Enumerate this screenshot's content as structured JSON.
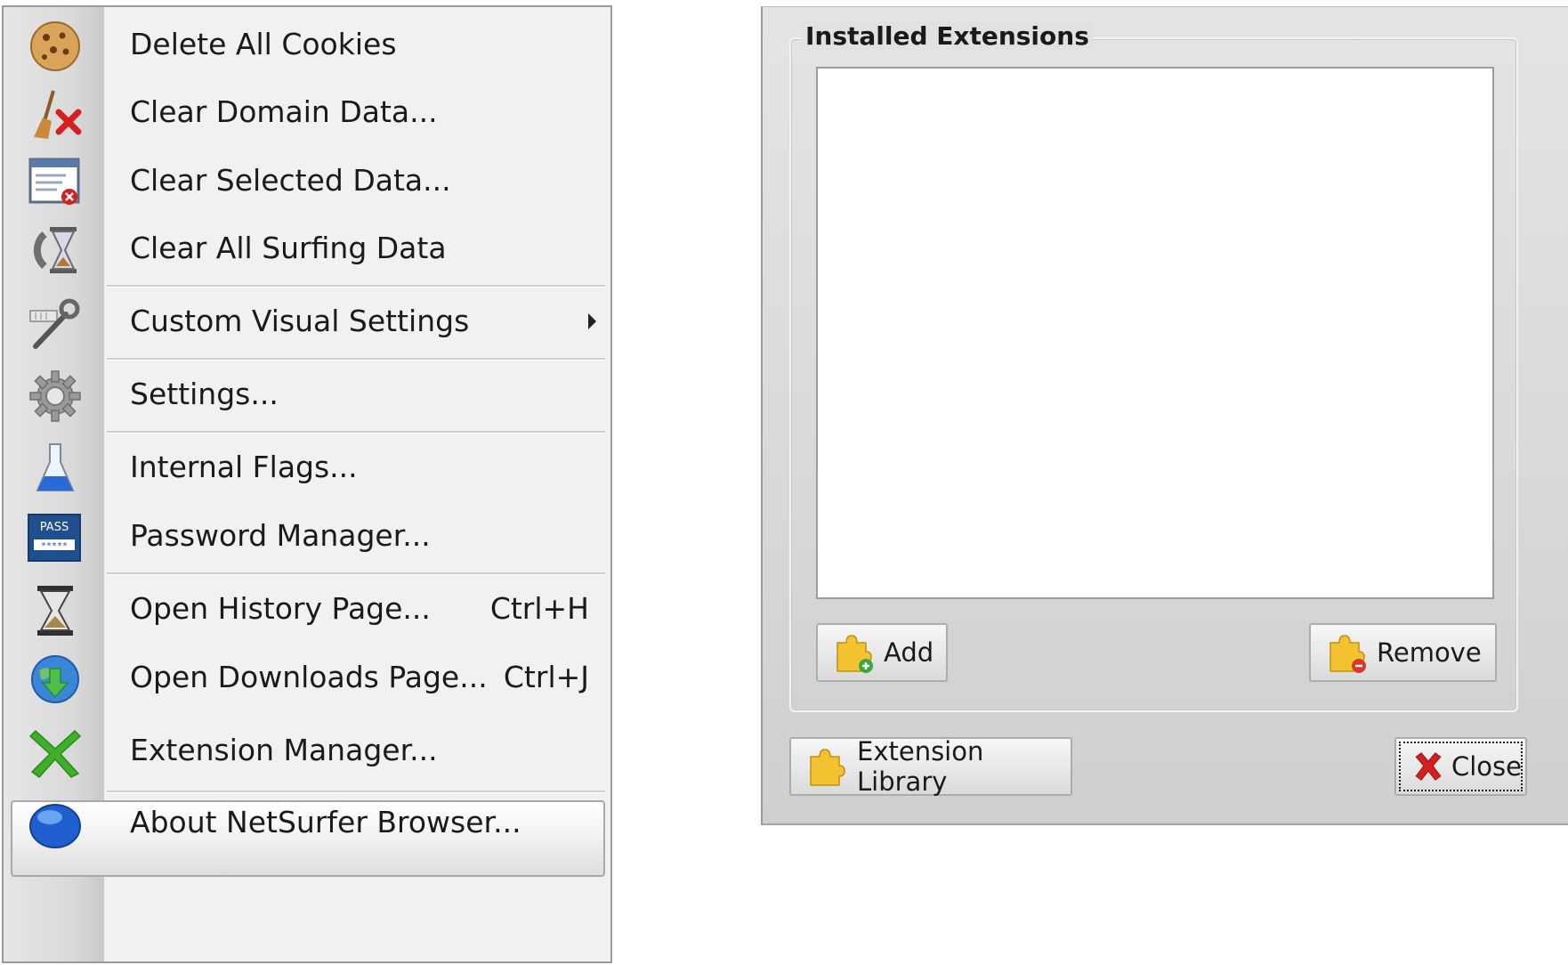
{
  "menu": {
    "items": [
      {
        "label": "Delete All Cookies",
        "icon": "cookie-icon"
      },
      {
        "label": "Clear Domain Data...",
        "icon": "broom-delete-icon"
      },
      {
        "label": "Clear Selected Data...",
        "icon": "window-delete-icon"
      },
      {
        "label": "Clear All Surfing Data",
        "icon": "hourglass-reset-icon"
      },
      {
        "label": "Custom Visual Settings",
        "icon": "wrench-tools-icon"
      },
      {
        "label": "Settings...",
        "icon": "gear-icon"
      },
      {
        "label": "Internal Flags...",
        "icon": "flask-icon"
      },
      {
        "label": "Password Manager...",
        "icon": "password-icon",
        "icon_text": "PASS"
      },
      {
        "label": "Open History Page...",
        "shortcut": "Ctrl+H",
        "icon": "hourglass-icon"
      },
      {
        "label": "Open Downloads Page...",
        "shortcut": "Ctrl+J",
        "icon": "globe-download-icon"
      },
      {
        "label": "Extension Manager...",
        "icon": "green-x-icon",
        "highlighted": true
      },
      {
        "label": "About NetSurfer Browser...",
        "icon": "blue-sphere-icon"
      }
    ]
  },
  "dialog": {
    "group_title": "Installed Extensions",
    "add_label": "Add",
    "remove_label": "Remove",
    "library_label": "Extension Library",
    "close_label": "Close",
    "colors": {
      "puzzle": "#f2c230",
      "add_badge": "#3aa83a",
      "remove_badge": "#d83a2a",
      "close_x": "#d42020"
    }
  }
}
